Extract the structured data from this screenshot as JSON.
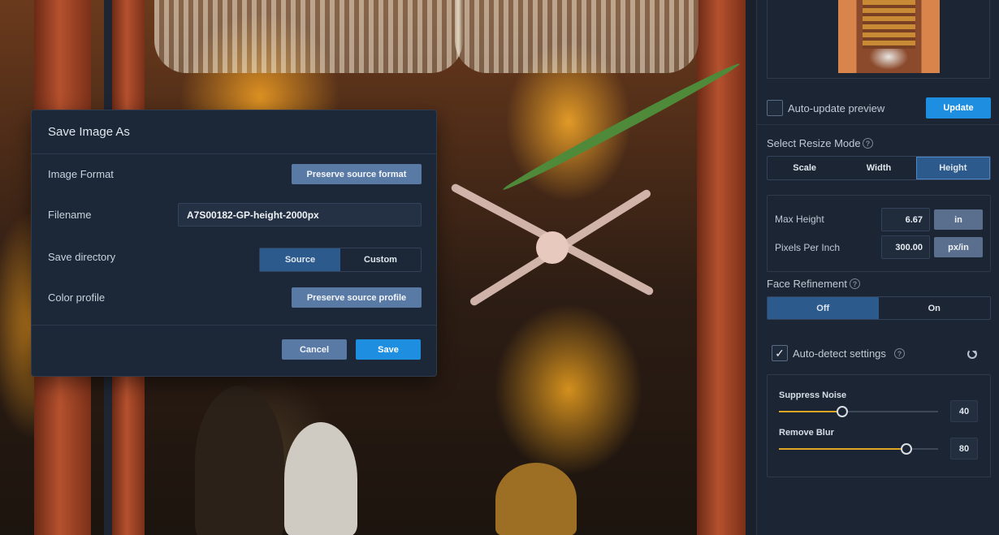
{
  "dialog": {
    "title": "Save Image As",
    "image_format_label": "Image Format",
    "image_format_value": "Preserve source format",
    "filename_label": "Filename",
    "filename_value": "A7S00182-GP-height-2000px",
    "save_dir_label": "Save directory",
    "save_dir_options": [
      "Source",
      "Custom"
    ],
    "save_dir_selected": "Source",
    "color_profile_label": "Color profile",
    "color_profile_value": "Preserve source profile",
    "cancel_label": "Cancel",
    "save_label": "Save"
  },
  "panel": {
    "auto_update_label": "Auto-update preview",
    "auto_update_checked": false,
    "update_label": "Update",
    "resize_mode_label": "Select Resize Mode",
    "resize_modes": [
      "Scale",
      "Width",
      "Height"
    ],
    "resize_mode_selected": "Height",
    "max_height_label": "Max Height",
    "max_height_value": "6.67",
    "max_height_unit": "in",
    "ppi_label": "Pixels Per Inch",
    "ppi_value": "300.00",
    "ppi_unit": "px/in",
    "face_refinement_label": "Face Refinement",
    "face_options": [
      "Off",
      "On"
    ],
    "face_selected": "Off",
    "auto_detect_label": "Auto-detect settings",
    "auto_detect_checked": true,
    "check_glyph": "✓",
    "help_glyph": "?",
    "sliders": [
      {
        "label": "Suppress Noise",
        "value": "40",
        "fraction": 0.4
      },
      {
        "label": "Remove Blur",
        "value": "80",
        "fraction": 0.8
      }
    ]
  },
  "colors": {
    "accent_blue": "#1e8fe0",
    "selected_segment": "#2c5a8c",
    "slider_fill": "#e0a521",
    "soft_button": "#5a7aa6"
  }
}
